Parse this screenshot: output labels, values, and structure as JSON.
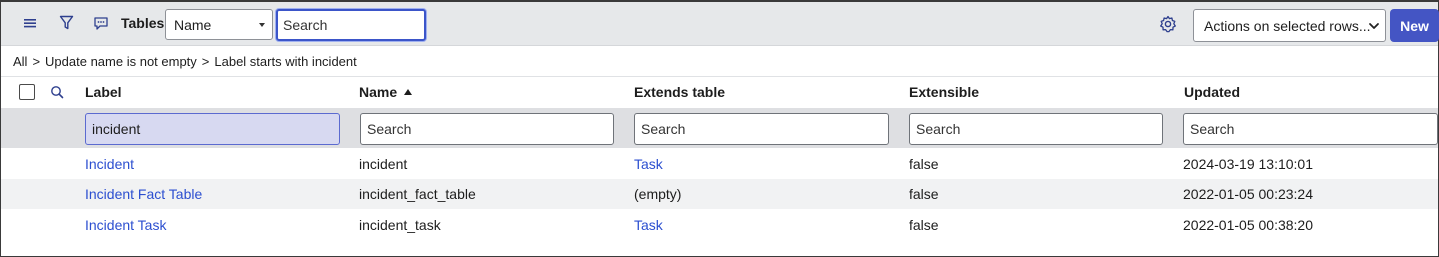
{
  "header": {
    "title": "Tables",
    "field_select": "Name",
    "search_placeholder": "Search",
    "actions_label": "Actions on selected rows...",
    "new_label": "New"
  },
  "breadcrumb": {
    "items": [
      "All",
      "Update name is not empty",
      "Label starts with incident"
    ],
    "separator": ">"
  },
  "columns": {
    "label": "Label",
    "name": "Name",
    "extends": "Extends table",
    "extensible": "Extensible",
    "updated": "Updated"
  },
  "filters": {
    "label": "incident",
    "name_placeholder": "Search",
    "extends_placeholder": "Search",
    "extensible_placeholder": "Search",
    "updated_placeholder": "Search"
  },
  "rows": [
    {
      "label": "Incident",
      "name": "incident",
      "extends": "Task",
      "extensible": "false",
      "updated": "2024-03-19 13:10:01"
    },
    {
      "label": "Incident Fact Table",
      "name": "incident_fact_table",
      "extends": "(empty)",
      "extensible": "false",
      "updated": "2022-01-05 00:23:24"
    },
    {
      "label": "Incident Task",
      "name": "incident_task",
      "extends": "Task",
      "extensible": "false",
      "updated": "2022-01-05 00:38:20"
    }
  ],
  "colors": {
    "accent": "#4455c4",
    "link": "#2c4fd0",
    "header_bg": "#e6e8ea"
  },
  "icons": [
    "menu-icon",
    "filter-icon",
    "comment-icon",
    "gear-icon",
    "search-icon"
  ]
}
